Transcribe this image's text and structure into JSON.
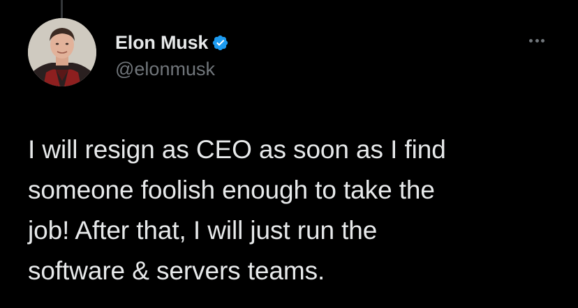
{
  "author": {
    "display_name": "Elon Musk",
    "handle": "@elonmusk",
    "verified": true
  },
  "tweet": {
    "lines": [
      "I will resign as CEO as soon as I find",
      "someone foolish enough to take the",
      "job! After that, I will just run the",
      "software & servers teams."
    ]
  },
  "icons": {
    "verified": "verified-badge-icon",
    "more": "more-horizontal-icon"
  },
  "colors": {
    "background": "#000000",
    "text": "#e7e9ea",
    "secondary_text": "#71767b",
    "verified_blue": "#1d9bf0"
  }
}
